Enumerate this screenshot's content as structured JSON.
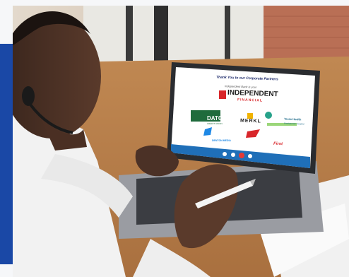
{
  "slide": {
    "heading": "Thank You to our Corporate Partners",
    "presenting_line": "Independent Bank is your",
    "bank_name": "INDEPENDENT",
    "bank_sub": "FINANCIAL",
    "datcu": "DATCU",
    "datcu_sub": "CREDIT UNION",
    "merkl": "MERKL",
    "texas_health": "Texas Health",
    "texas_health_sub": "Presbyterian Hospital",
    "denton": "DENTON MEDIA",
    "first": "First"
  },
  "colors": {
    "brand_blue": "#1a48a6",
    "slide_red": "#d8262a",
    "datcu_green": "#1f6b3c"
  }
}
